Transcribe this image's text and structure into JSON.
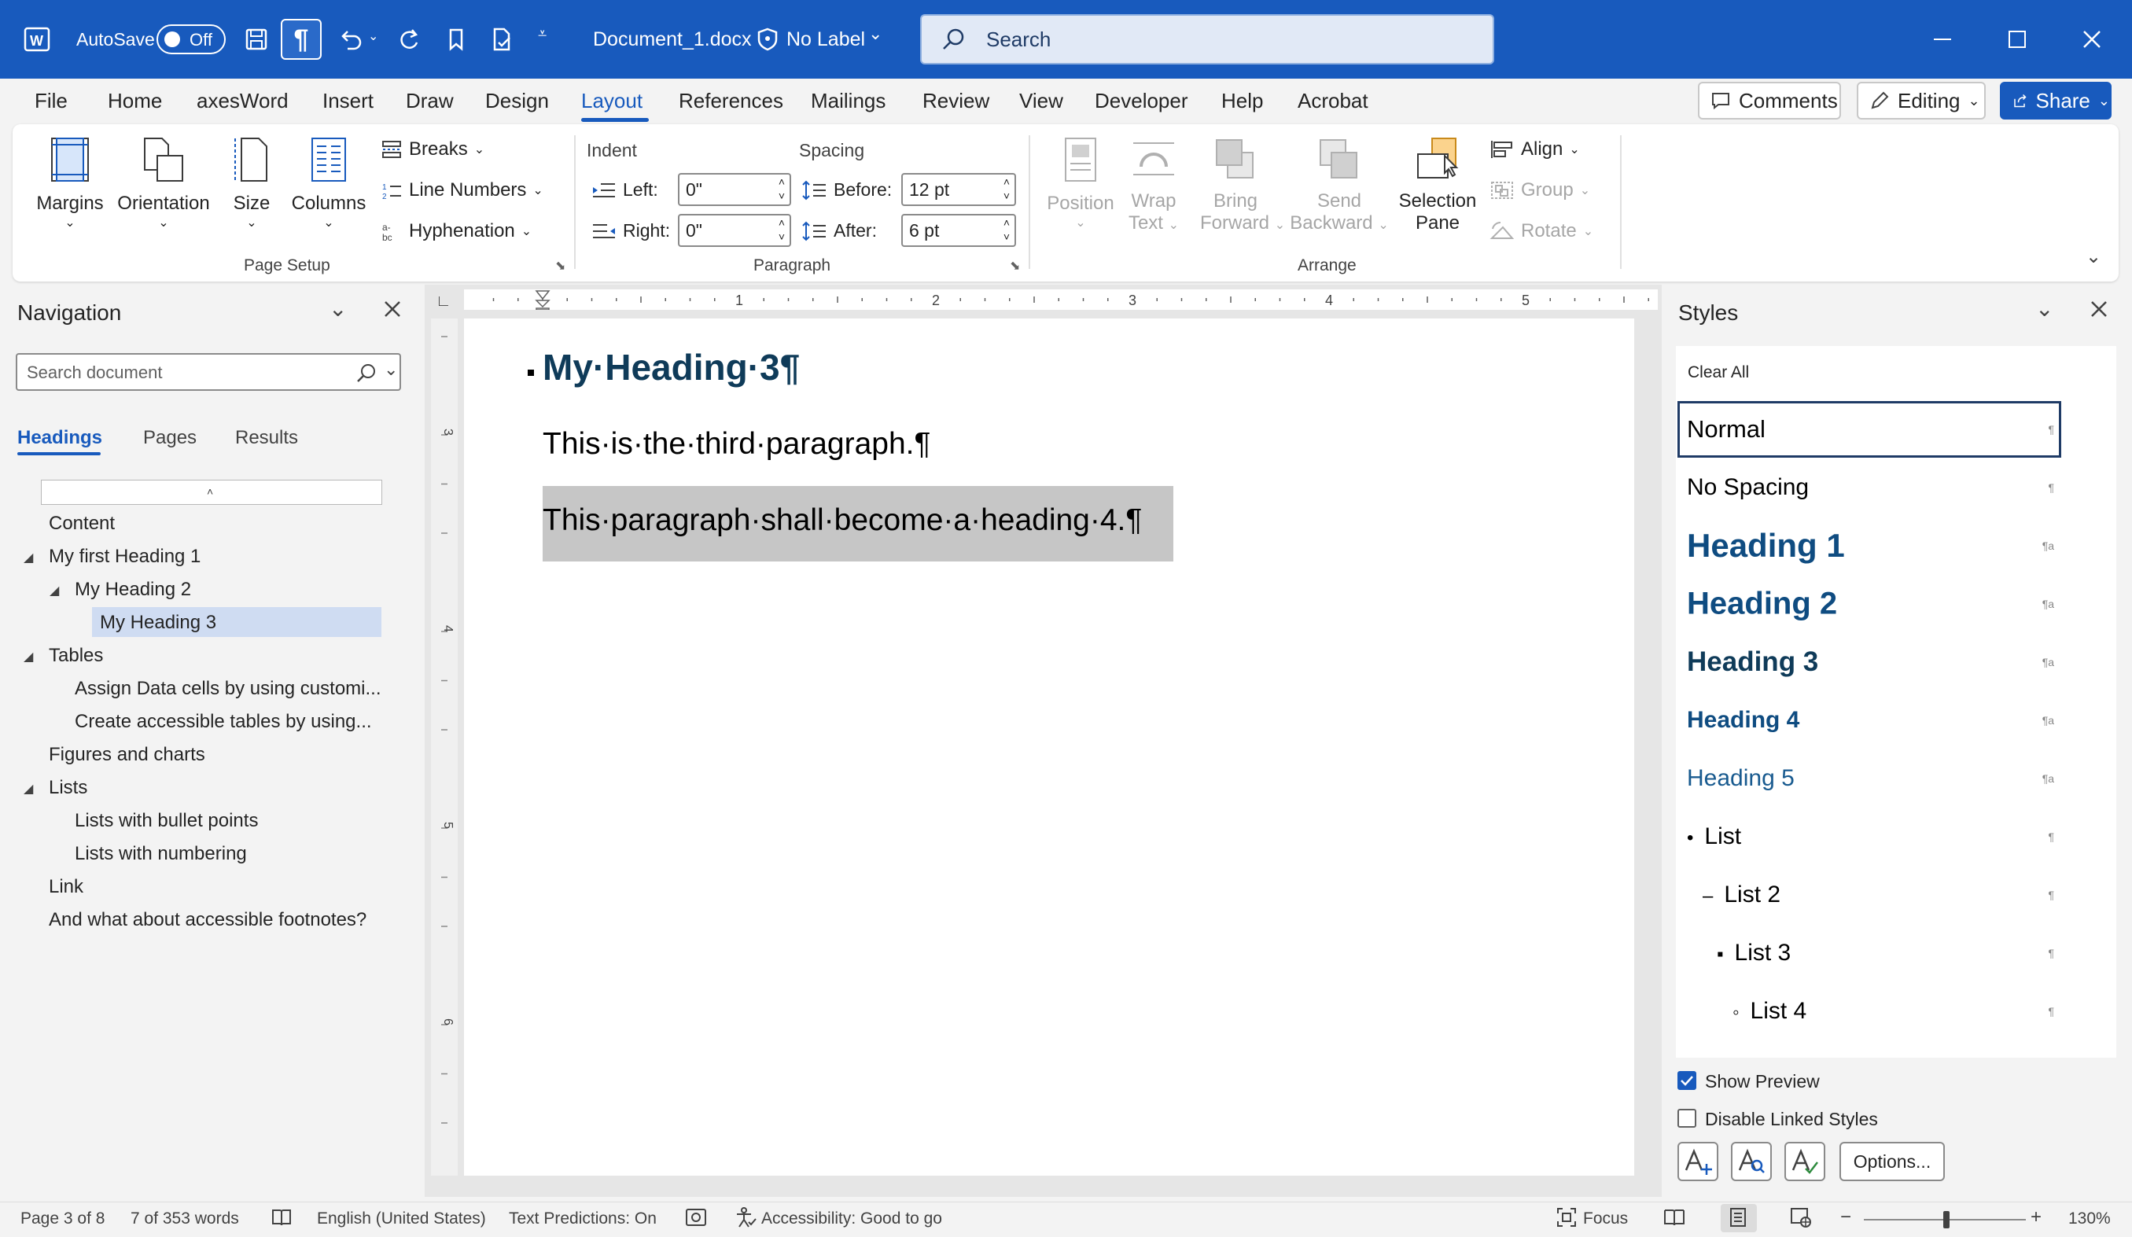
{
  "app": {
    "autosave_label": "AutoSave",
    "autosave_state": "Off",
    "document_name": "Document_1.docx",
    "sensitivity_label": "No Label",
    "search_placeholder": "Search",
    "accent_color": "#185abd"
  },
  "menu": {
    "tabs": [
      "File",
      "Home",
      "axesWord",
      "Insert",
      "Draw",
      "Design",
      "Layout",
      "References",
      "Mailings",
      "Review",
      "View",
      "Developer",
      "Help",
      "Acrobat"
    ],
    "active_tab": "Layout",
    "comments_label": "Comments",
    "editing_label": "Editing",
    "share_label": "Share"
  },
  "ribbon": {
    "page_setup": {
      "margins": "Margins",
      "orientation": "Orientation",
      "size": "Size",
      "columns": "Columns",
      "breaks": "Breaks",
      "line_numbers": "Line Numbers",
      "hyphenation": "Hyphenation",
      "group_label": "Page Setup"
    },
    "paragraph": {
      "indent_label": "Indent",
      "spacing_label": "Spacing",
      "left_label": "Left:",
      "left_value": "0\"",
      "right_label": "Right:",
      "right_value": "0\"",
      "before_label": "Before:",
      "before_value": "12 pt",
      "after_label": "After:",
      "after_value": "6 pt",
      "group_label": "Paragraph"
    },
    "arrange": {
      "position": "Position",
      "wrap_text_1": "Wrap",
      "wrap_text_2": "Text",
      "bring_forward_1": "Bring",
      "bring_forward_2": "Forward",
      "send_backward_1": "Send",
      "send_backward_2": "Backward",
      "selection_pane_1": "Selection",
      "selection_pane_2": "Pane",
      "align": "Align",
      "group": "Group",
      "rotate": "Rotate",
      "group_label": "Arrange"
    }
  },
  "navigation": {
    "title": "Navigation",
    "search_placeholder": "Search document",
    "tabs": [
      "Headings",
      "Pages",
      "Results"
    ],
    "active_tab": "Headings",
    "items": [
      {
        "label": "Content",
        "level": 1,
        "expander": false
      },
      {
        "label": "My first Heading 1",
        "level": 1,
        "expander": true
      },
      {
        "label": "My Heading 2",
        "level": 2,
        "expander": true
      },
      {
        "label": "My Heading 3",
        "level": 3,
        "expander": false,
        "selected": true
      },
      {
        "label": "Tables",
        "level": 1,
        "expander": true
      },
      {
        "label": "Assign Data cells by using customi...",
        "level": 2,
        "expander": false
      },
      {
        "label": "Create accessible tables by using...",
        "level": 2,
        "expander": false
      },
      {
        "label": "Figures and charts",
        "level": 1,
        "expander": false
      },
      {
        "label": "Lists",
        "level": 1,
        "expander": true
      },
      {
        "label": "Lists with bullet points",
        "level": 2,
        "expander": false
      },
      {
        "label": "Lists with numbering",
        "level": 2,
        "expander": false
      },
      {
        "label": "Link",
        "level": 1,
        "expander": false
      },
      {
        "label": "And what about accessible footnotes?",
        "level": 1,
        "expander": false
      }
    ]
  },
  "ruler": {
    "h_numbers": [
      "1",
      "2",
      "3",
      "4",
      "5"
    ],
    "v_numbers": [
      "3",
      "4",
      "5",
      "6"
    ]
  },
  "document": {
    "heading": "My·Heading·3¶",
    "para1": "This·is·the·third·paragraph.¶",
    "para2": "This·paragraph·shall·become·a·heading·4.¶"
  },
  "styles": {
    "title": "Styles",
    "clear_all": "Clear All",
    "items": [
      {
        "name": "Normal",
        "marker": "¶"
      },
      {
        "name": "No Spacing",
        "marker": "¶"
      },
      {
        "name": "Heading 1",
        "marker": "¶a"
      },
      {
        "name": "Heading 2",
        "marker": "¶a"
      },
      {
        "name": "Heading 3",
        "marker": "¶a"
      },
      {
        "name": "Heading 4",
        "marker": "¶a"
      },
      {
        "name": "Heading 5",
        "marker": "¶a"
      },
      {
        "name": "List",
        "marker": "¶",
        "bullet": "•"
      },
      {
        "name": "List 2",
        "marker": "¶",
        "bullet": "–"
      },
      {
        "name": "List 3",
        "marker": "¶",
        "bullet": "▪"
      },
      {
        "name": "List 4",
        "marker": "¶",
        "bullet": "◦"
      }
    ],
    "show_preview": "Show Preview",
    "show_preview_checked": true,
    "disable_linked": "Disable Linked Styles",
    "disable_linked_checked": false,
    "options_label": "Options..."
  },
  "status": {
    "page": "Page 3 of 8",
    "words": "7 of 353 words",
    "language": "English (United States)",
    "predictions": "Text Predictions: On",
    "accessibility": "Accessibility: Good to go",
    "focus": "Focus",
    "zoom": "130%"
  }
}
